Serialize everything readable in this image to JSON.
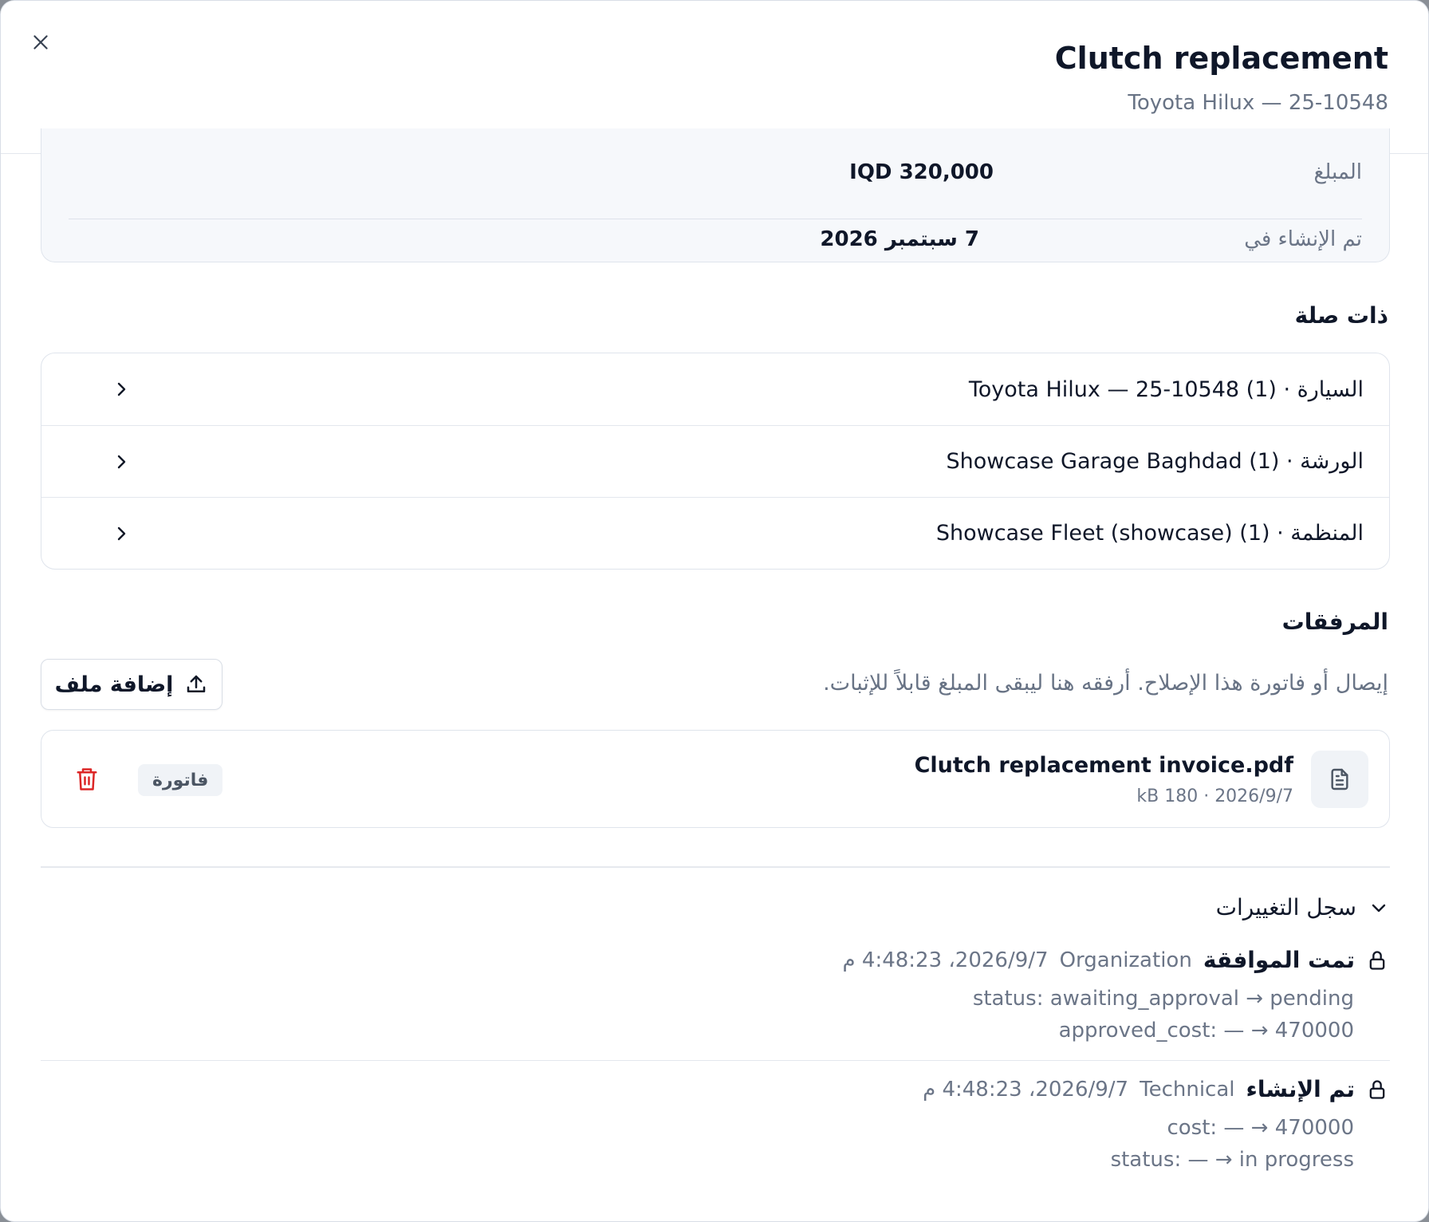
{
  "header": {
    "title": "Clutch replacement",
    "subtitle": "Toyota Hilux — 25-10548",
    "close_icon": "close-icon"
  },
  "details": {
    "amount_label": "المبلغ",
    "amount_value": "IQD 320,000",
    "created_label": "تم الإنشاء في",
    "created_value": "7 سبتمبر 2026"
  },
  "related": {
    "title": "ذات صلة",
    "items": [
      {
        "label": "السيارة · Toyota Hilux — 25-10548 (1)"
      },
      {
        "label": "الورشة · Showcase Garage Baghdad (1)"
      },
      {
        "label": "المنظمة · Showcase Fleet (showcase) (1)"
      }
    ]
  },
  "attachments": {
    "title": "المرفقات",
    "description": "إيصال أو فاتورة هذا الإصلاح. أرفقه هنا ليبقى المبلغ قابلاً للإثبات.",
    "add_button": "إضافة ملف",
    "files": [
      {
        "name": "Clutch replacement invoice.pdf",
        "meta": "kB 180 · 2026/9/7",
        "badge": "فاتورة"
      }
    ]
  },
  "changelog": {
    "title": "سجل التغييرات",
    "entries": [
      {
        "action": "تمت الموافقة",
        "actor": "Organization",
        "time": "2026/9/7، 4:48:23 م",
        "changes": [
          "status: awaiting_approval → pending",
          "approved_cost: — → 470000"
        ]
      },
      {
        "action": "تم الإنشاء",
        "actor": "Technical",
        "time": "2026/9/7، 4:48:23 م",
        "changes": [
          "cost: — → 470000",
          "status: — → in progress"
        ]
      }
    ]
  },
  "colors": {
    "accent_danger": "#dc2626",
    "muted_text": "#687385",
    "card_bg": "#f6f8fb"
  }
}
